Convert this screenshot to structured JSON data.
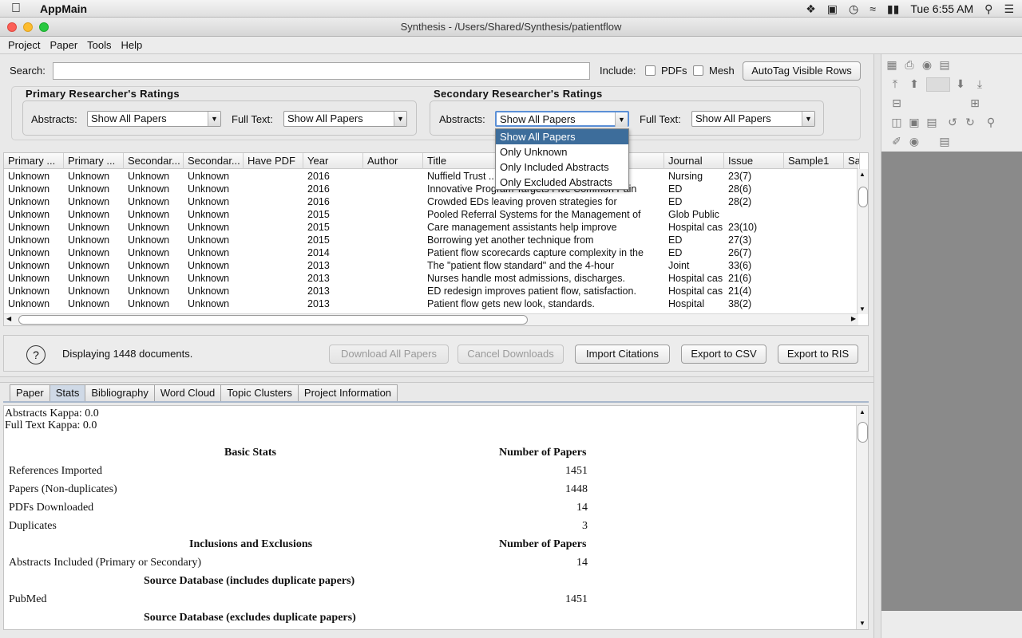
{
  "menubar": {
    "app_name": "AppMain",
    "clock": "Tue 6:55 AM"
  },
  "window": {
    "title": "Synthesis - /Users/Shared/Synthesis/patientflow"
  },
  "app_menu": [
    "Project",
    "Paper",
    "Tools",
    "Help"
  ],
  "search": {
    "label": "Search:",
    "value": "",
    "include_label": "Include:",
    "pdfs_label": "PDFs",
    "mesh_label": "Mesh",
    "pdfs_checked": false,
    "mesh_checked": false,
    "autotag_button": "AutoTag Visible Rows"
  },
  "filters": {
    "primary": {
      "title": "Primary Researcher's  Ratings",
      "abstracts_label": "Abstracts:",
      "abstracts_value": "Show All Papers",
      "fulltext_label": "Full Text:",
      "fulltext_value": "Show All Papers"
    },
    "secondary": {
      "title": "Secondary Researcher's  Ratings",
      "abstracts_label": "Abstracts:",
      "abstracts_value": "Show All Papers",
      "fulltext_label": "Full Text:",
      "fulltext_value": "Show All Papers"
    }
  },
  "dropdown": {
    "options": [
      "Show All Papers",
      "Only Unknown",
      "Only Included Abstracts",
      "Only Excluded Abstracts"
    ],
    "selected": "Show All Papers"
  },
  "table": {
    "columns": [
      "Primary ...",
      "Primary ...",
      "Secondar...",
      "Secondar...",
      "Have PDF",
      "Year",
      "Author",
      "Title",
      "Journal",
      "Issue",
      "Sample1",
      "Sa"
    ],
    "rows": [
      [
        "Unknown",
        "Unknown",
        "Unknown",
        "Unknown",
        "",
        "2016",
        "",
        "Nuffield Trust ...cted",
        "Nursing",
        "23(7)",
        ""
      ],
      [
        "Unknown",
        "Unknown",
        "Unknown",
        "Unknown",
        "",
        "2016",
        "",
        "Innovative Program Targets Five Common Pain",
        "ED",
        "28(6)",
        ""
      ],
      [
        "Unknown",
        "Unknown",
        "Unknown",
        "Unknown",
        "",
        "2016",
        "",
        "Crowded EDs leaving proven strategies for",
        "ED",
        "28(2)",
        ""
      ],
      [
        "Unknown",
        "Unknown",
        "Unknown",
        "Unknown",
        "",
        "2015",
        "",
        "Pooled Referral Systems for the Management of",
        "Glob Public",
        "",
        ""
      ],
      [
        "Unknown",
        "Unknown",
        "Unknown",
        "Unknown",
        "",
        "2015",
        "",
        "Care management assistants help improve",
        "Hospital cas",
        "23(10)",
        ""
      ],
      [
        "Unknown",
        "Unknown",
        "Unknown",
        "Unknown",
        "",
        "2015",
        "",
        "Borrowing yet another technique from",
        "ED",
        "27(3)",
        ""
      ],
      [
        "Unknown",
        "Unknown",
        "Unknown",
        "Unknown",
        "",
        "2014",
        "",
        "Patient flow scorecards capture complexity in the",
        "ED",
        "26(7)",
        ""
      ],
      [
        "Unknown",
        "Unknown",
        "Unknown",
        "Unknown",
        "",
        "2013",
        "",
        "The \"patient flow standard\" and the 4-hour",
        "Joint",
        "33(6)",
        ""
      ],
      [
        "Unknown",
        "Unknown",
        "Unknown",
        "Unknown",
        "",
        "2013",
        "",
        "Nurses handle most admissions, discharges.",
        "Hospital cas",
        "21(6)",
        ""
      ],
      [
        "Unknown",
        "Unknown",
        "Unknown",
        "Unknown",
        "",
        "2013",
        "",
        "ED redesign improves patient flow, satisfaction.",
        "Hospital cas",
        "21(4)",
        ""
      ],
      [
        "Unknown",
        "Unknown",
        "Unknown",
        "Unknown",
        "",
        "2013",
        "",
        "Patient flow gets new look, standards.",
        "Hospital",
        "38(2)",
        ""
      ]
    ]
  },
  "actions": {
    "help": "?",
    "status": "Displaying 1448 documents.",
    "download_all": "Download All Papers",
    "cancel_downloads": "Cancel Downloads",
    "import_citations": "Import Citations",
    "export_csv": "Export to CSV",
    "export_ris": "Export to RIS"
  },
  "tabs": [
    "Paper",
    "Stats",
    "Bibliography",
    "Word Cloud",
    "Topic Clusters",
    "Project Information"
  ],
  "active_tab": "Stats",
  "stats": {
    "abstracts_kappa": "Abstracts Kappa: 0.0",
    "fulltext_kappa": "Full Text Kappa: 0.0",
    "basic_header": "Basic Stats",
    "count_header": "Number of Papers",
    "basic_rows": [
      {
        "label": "References Imported",
        "value": "1451"
      },
      {
        "label": "Papers (Non-duplicates)",
        "value": "1448"
      },
      {
        "label": "PDFs Downloaded",
        "value": "14"
      },
      {
        "label": "Duplicates",
        "value": "3"
      }
    ],
    "incl_header": "Inclusions and Exclusions",
    "incl_count_header": "Number of Papers",
    "incl_rows": [
      {
        "label": "Abstracts Included (Primary or Secondary)",
        "value": "14"
      }
    ],
    "source_incl_header": "Source Database (includes duplicate papers)",
    "source_incl_rows": [
      {
        "label": "PubMed",
        "value": "1451"
      }
    ],
    "source_excl_header": "Source Database (excludes duplicate papers)"
  }
}
